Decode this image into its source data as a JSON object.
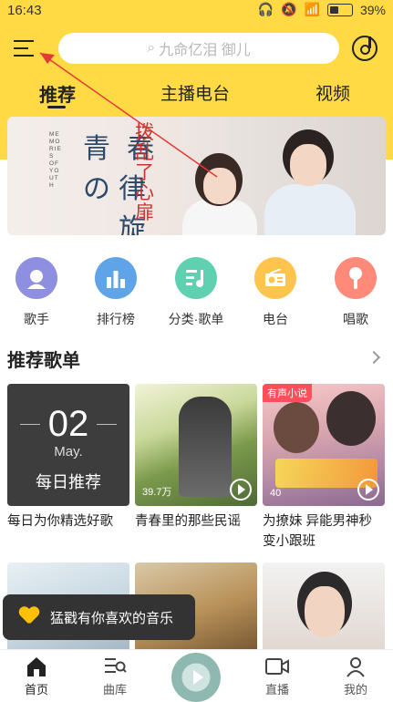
{
  "status_bar": {
    "time": "16:43",
    "battery": "39%"
  },
  "header": {
    "search_placeholder": "九命亿泪 御儿",
    "tabs": [
      {
        "label": "推荐"
      },
      {
        "label": "主播电台"
      },
      {
        "label": "视频"
      }
    ]
  },
  "banner": {
    "title_chars": [
      "青",
      "春",
      "の",
      "律"
    ],
    "title_chars2": [
      "旋"
    ],
    "side_text": "MEMORIES OF YOUTH",
    "subtitle": "拨乱了心扉"
  },
  "categories": [
    {
      "label": "歌手",
      "icon": "singer-icon",
      "color": "#8E8FE0"
    },
    {
      "label": "排行榜",
      "icon": "chart-icon",
      "color": "#5FA3E8"
    },
    {
      "label": "分类·歌单",
      "icon": "playlist-icon",
      "color": "#5FD0B0"
    },
    {
      "label": "电台",
      "icon": "radio-icon",
      "color": "#FFC44D"
    },
    {
      "label": "唱歌",
      "icon": "mic-icon",
      "color": "#FF8A7A"
    }
  ],
  "recommend": {
    "title": "推荐歌单",
    "row1": [
      {
        "caption": "每日为你精选好歌",
        "day": "02",
        "month": "May.",
        "label": "每日推荐"
      },
      {
        "caption": "青春里的那些民谣",
        "play_count": "39.7万"
      },
      {
        "caption": "为撩妹 异能男神秒变小跟班",
        "tag": "有声小说",
        "play_count": "40"
      }
    ]
  },
  "toast": {
    "text": "猛戳有你喜欢的音乐"
  },
  "bottom_nav": [
    {
      "label": "首页"
    },
    {
      "label": "曲库"
    },
    {
      "label": "直播"
    },
    {
      "label": "我的"
    }
  ],
  "colors": {
    "brand_yellow": "#FFDA44",
    "annotation_red": "#E53935"
  }
}
